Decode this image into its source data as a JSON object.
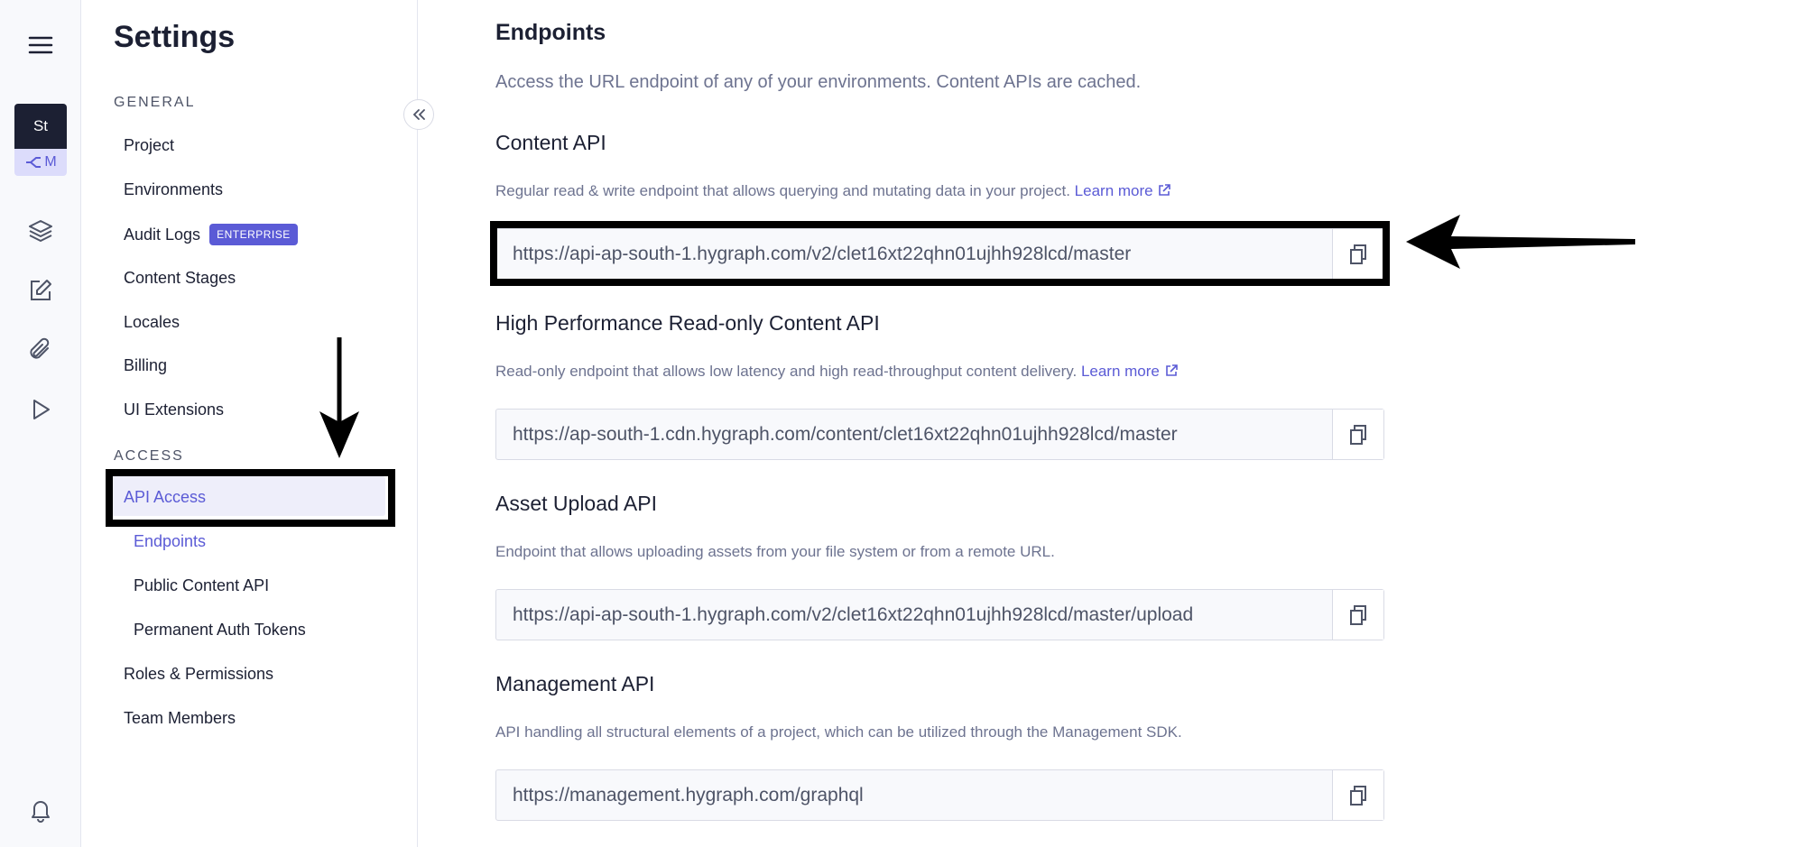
{
  "rail": {
    "project_initials": "St",
    "env_initial": "M"
  },
  "nav": {
    "title": "Settings",
    "general_label": "GENERAL",
    "access_label": "ACCESS",
    "items": {
      "project": "Project",
      "environments": "Environments",
      "audit_logs": "Audit Logs",
      "enterprise_badge": "ENTERPRISE",
      "content_stages": "Content Stages",
      "locales": "Locales",
      "billing": "Billing",
      "ui_extensions": "UI Extensions",
      "api_access": "API Access",
      "endpoints": "Endpoints",
      "public_content_api": "Public Content API",
      "permanent_auth_tokens": "Permanent Auth Tokens",
      "roles_permissions": "Roles & Permissions",
      "team_members": "Team Members"
    }
  },
  "main": {
    "title": "Endpoints",
    "intro": "Access the URL endpoint of any of your environments. Content APIs are cached.",
    "learn_more": "Learn more",
    "sections": [
      {
        "title": "Content API",
        "description": "Regular read & write endpoint that allows querying and mutating data in your project.",
        "url": "https://api-ap-south-1.hygraph.com/v2/clet16xt22qhn01ujhh928lcd/master"
      },
      {
        "title": "High Performance Read-only Content API",
        "description": "Read-only endpoint that allows low latency and high read-throughput content delivery.",
        "url": "https://ap-south-1.cdn.hygraph.com/content/clet16xt22qhn01ujhh928lcd/master"
      },
      {
        "title": "Asset Upload API",
        "description": "Endpoint that allows uploading assets from your file system or from a remote URL.",
        "url": "https://api-ap-south-1.hygraph.com/v2/clet16xt22qhn01ujhh928lcd/master/upload"
      },
      {
        "title": "Management API",
        "description": "API handling all structural elements of a project, which can be utilized through the Management SDK.",
        "url": "https://management.hygraph.com/graphql"
      }
    ]
  },
  "colors": {
    "accent": "#5b5bd6",
    "text": "#1c2033",
    "muted": "#6d7390"
  }
}
